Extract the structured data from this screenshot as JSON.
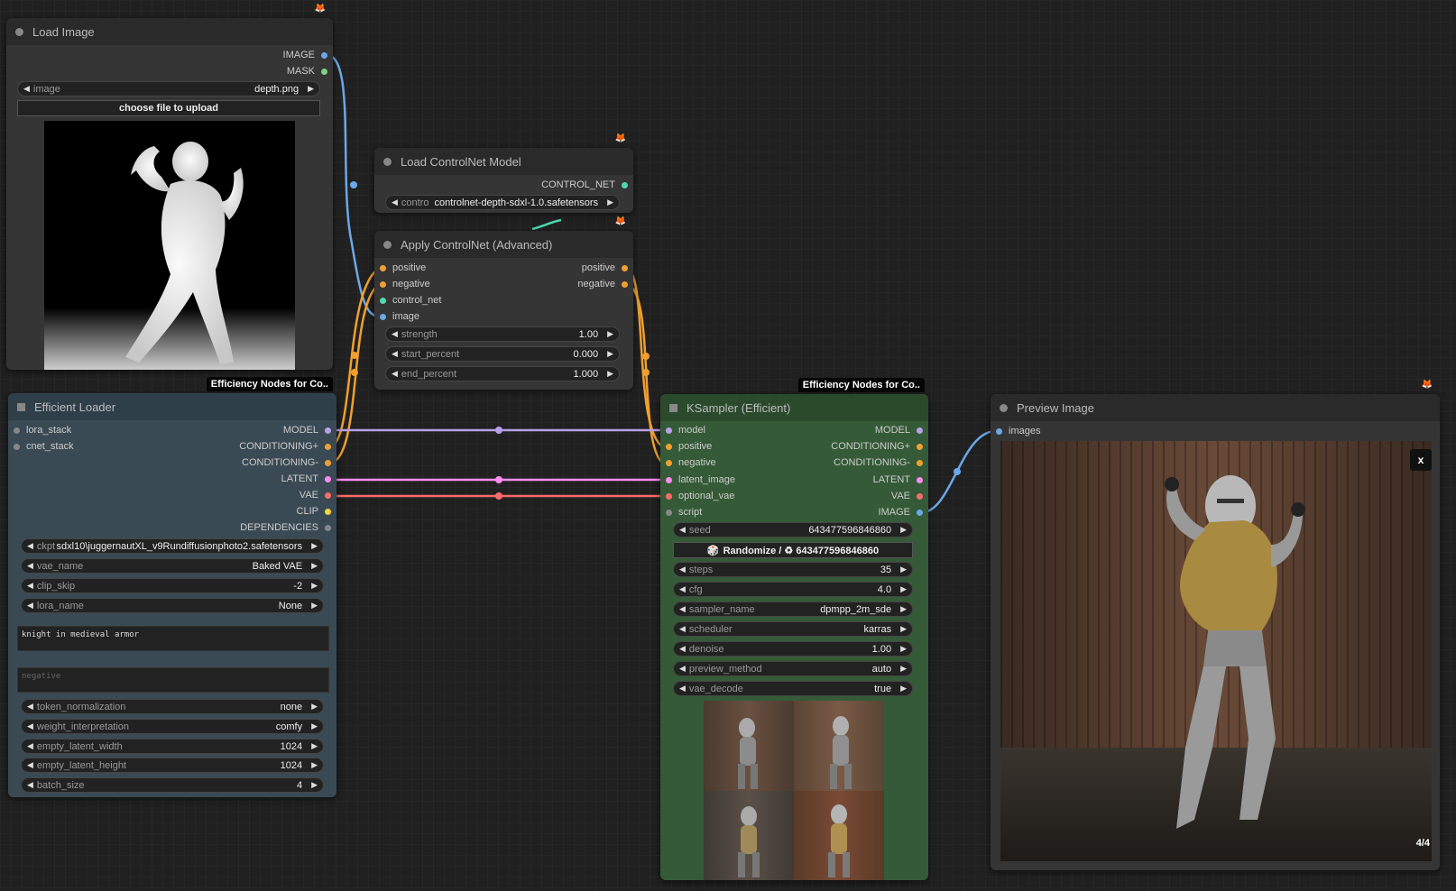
{
  "colors": {
    "image": "#6aa8e8",
    "mask": "#7dd37d",
    "control_net": "#4fd8b0",
    "conditioning": "#f0a030",
    "model": "#b9a0e8",
    "latent": "#ff8cf0",
    "vae": "#ff6a6a",
    "clip": "#ffd43b",
    "gray": "#888888"
  },
  "load_image": {
    "title": "Load Image",
    "outputs": [
      "IMAGE",
      "MASK"
    ],
    "image_widget": {
      "label": "image",
      "value": "depth.png"
    },
    "upload_button": "choose file to upload"
  },
  "load_controlnet": {
    "title": "Load ControlNet Model",
    "output": "CONTROL_NET",
    "widget": {
      "label": "contro",
      "value": "controlnet-depth-sdxl-1.0.safetensors"
    }
  },
  "apply_controlnet": {
    "title": "Apply ControlNet (Advanced)",
    "inputs": [
      "positive",
      "negative",
      "control_net",
      "image"
    ],
    "outputs": [
      "positive",
      "negative"
    ],
    "widgets": [
      {
        "label": "strength",
        "value": "1.00"
      },
      {
        "label": "start_percent",
        "value": "0.000"
      },
      {
        "label": "end_percent",
        "value": "1.000"
      }
    ]
  },
  "efficient_loader": {
    "badge": "Efficiency Nodes for Co..",
    "title": "Efficient Loader",
    "inputs": [
      "lora_stack",
      "cnet_stack"
    ],
    "outputs": [
      "MODEL",
      "CONDITIONING+",
      "CONDITIONING-",
      "LATENT",
      "VAE",
      "CLIP",
      "DEPENDENCIES"
    ],
    "widgets_top": [
      {
        "label": "ckpt",
        "value": "sdxl10\\juggernautXL_v9Rundiffusionphoto2.safetensors"
      },
      {
        "label": "vae_name",
        "value": "Baked VAE"
      },
      {
        "label": "clip_skip",
        "value": "-2"
      },
      {
        "label": "lora_name",
        "value": "None"
      }
    ],
    "positive_prompt": "knight in medieval armor",
    "negative_placeholder": "negative",
    "widgets_bottom": [
      {
        "label": "token_normalization",
        "value": "none"
      },
      {
        "label": "weight_interpretation",
        "value": "comfy"
      },
      {
        "label": "empty_latent_width",
        "value": "1024"
      },
      {
        "label": "empty_latent_height",
        "value": "1024"
      },
      {
        "label": "batch_size",
        "value": "4"
      }
    ]
  },
  "ksampler": {
    "badge": "Efficiency Nodes for Co..",
    "title": "KSampler (Efficient)",
    "inputs": [
      "model",
      "positive",
      "negative",
      "latent_image",
      "optional_vae",
      "script"
    ],
    "outputs": [
      "MODEL",
      "CONDITIONING+",
      "CONDITIONING-",
      "LATENT",
      "VAE",
      "IMAGE"
    ],
    "seed": {
      "label": "seed",
      "value": "643477596846860"
    },
    "randomize_button": "Randomize / ♻ 643477596846860",
    "widgets": [
      {
        "label": "steps",
        "value": "35"
      },
      {
        "label": "cfg",
        "value": "4.0"
      },
      {
        "label": "sampler_name",
        "value": "dpmpp_2m_sde"
      },
      {
        "label": "scheduler",
        "value": "karras"
      },
      {
        "label": "denoise",
        "value": "1.00"
      },
      {
        "label": "preview_method",
        "value": "auto"
      },
      {
        "label": "vae_decode",
        "value": "true"
      }
    ]
  },
  "preview_image": {
    "title": "Preview Image",
    "input": "images",
    "close_label": "x",
    "counter": "4/4"
  }
}
